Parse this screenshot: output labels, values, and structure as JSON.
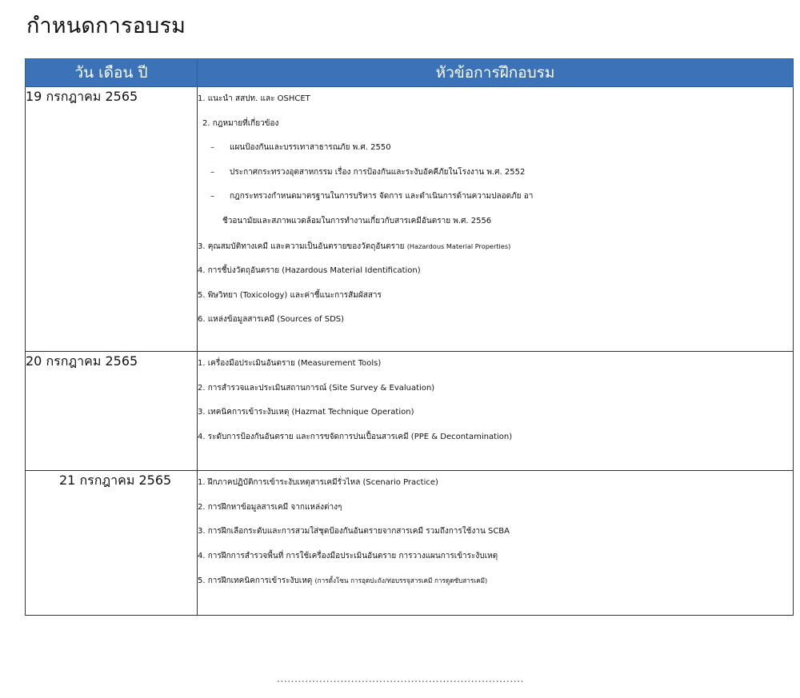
{
  "page_title": "กำหนดการอบรม",
  "table": {
    "headers": [
      "วัน เดือน ปี",
      "หัวข้อการฝึกอบรม"
    ],
    "rows": [
      {
        "date": "19 กรกฎาคม 2565",
        "lines": [
          "1. แนะนำ สสปท. และ OSHCET",
          "2. กฎหมายที่เกี่ยวข้อง",
          "แผนป้องกันและบรรเทาสาธารณภัย พ.ศ. 2550",
          "ประกาศกระทรวงอุตสาหกรรม เรื่อง การป้องกันและระงับอัคคีภัยในโรงงาน พ.ศ. 2552",
          "กฎกระทรวงกำหนดมาตรฐานในการบริหาร จัดการ และดำเนินการด้านความปลอดภัย อา",
          "ชีวอนามัยและสภาพแวดล้อมในการทำงานเกี่ยวกับสารเคมีอันตราย พ.ศ. 2556",
          "3. คุณสมบัติทางเคมี และความเป็นอันตรายของวัตถุอันตราย",
          "(Hazardous Material Properties)",
          "4. การชี้บ่งวัตถุอันตราย (Hazardous Material Identification)",
          "5. พิษวิทยา (Toxicology) และค่าชี้แนะการสัมผัสสาร",
          "6. แหล่งข้อมูลสารเคมี (Sources of SDS)"
        ]
      },
      {
        "date": "20 กรกฎาคม 2565",
        "lines": [
          "1.  เครื่องมือประเมินอันตราย (Measurement Tools)",
          "2.  การสำรวจและประเมินสถานการณ์ (Site Survey & Evaluation)",
          "3.  เทคนิคการเข้าระงับเหตุ (Hazmat Technique Operation)",
          "4.  ระดับการป้องกันอันตราย และการขจัดการปนเปื้อนสารเคมี (PPE & Decontamination)"
        ]
      },
      {
        "date": "21  กรกฎาคม 2565",
        "lines": [
          "1.  ฝึกภาคปฏิบัติการเข้าระงับเหตุสารเคมีรั่วไหล (Scenario Practice)",
          "2.  การฝึกหาข้อมูลสารเคมี จากแหล่งต่างๆ",
          "3.  การฝึกเลือกระดับและการสวมใส่ชุดป้องกันอันตรายจากสารเคมี รวมถึงการใช้งาน SCBA",
          "4.  การฝึกการสำรวจพื้นที่ การใช้เครื่องมือประเมินอันตราย การวางแผนการเข้าระงับเหตุ",
          "5.  การฝึกเทคนิคการเข้าระงับเหตุ",
          "(การตั้งโซน การอุดปะถัง/ท่อบรรจุสารเคมี การดูดซับสารเคมี)"
        ]
      }
    ]
  },
  "bullet_dash": "–",
  "footer_dots": "......................................................................",
  "colors": {
    "header_bg": "#3c72b8",
    "header_text": "#ffffff",
    "border": "#333333"
  }
}
